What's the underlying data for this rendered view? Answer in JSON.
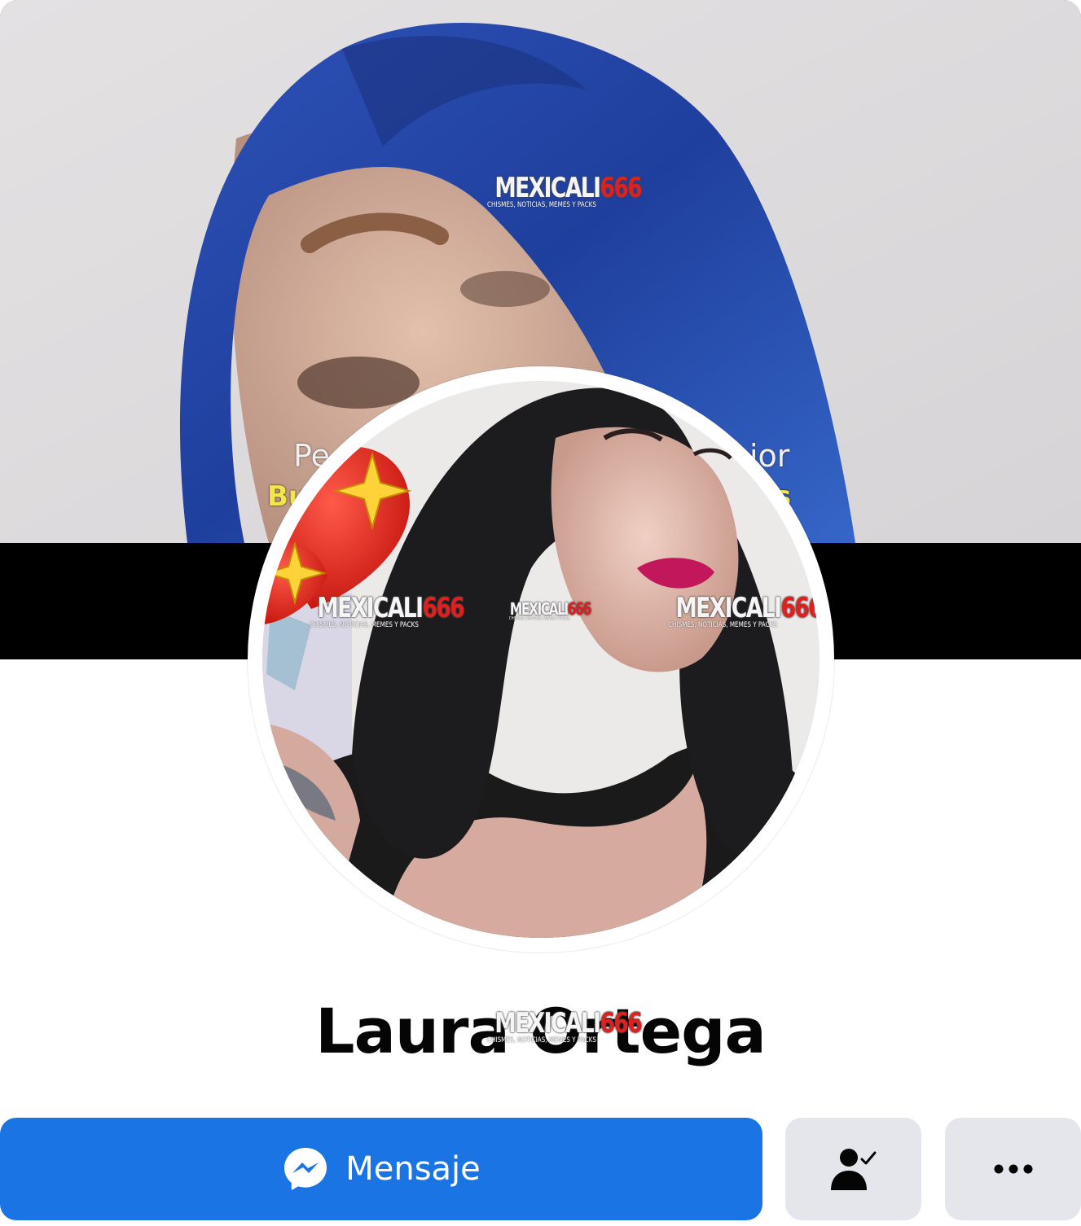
{
  "cover": {
    "caption_line1_left": "Pe",
    "caption_line1_right": "ior",
    "caption_line2_left": "Bu",
    "caption_line2_right": "es"
  },
  "watermark": {
    "main_text": "MEXICALI",
    "main_highlight": "666",
    "subtitle": "CHISMES, NOTICIAS, MEMES Y PACKS"
  },
  "profile": {
    "name": "Laura Ortega"
  },
  "actions": {
    "message_label": "Mensaje",
    "friends_icon": "friends-check-icon",
    "more_icon": "more-dots-icon"
  },
  "colors": {
    "primary": "#1b74e4",
    "secondary_button": "#e4e6eb",
    "text": "#050505",
    "watermark_accent": "#e0201f"
  }
}
